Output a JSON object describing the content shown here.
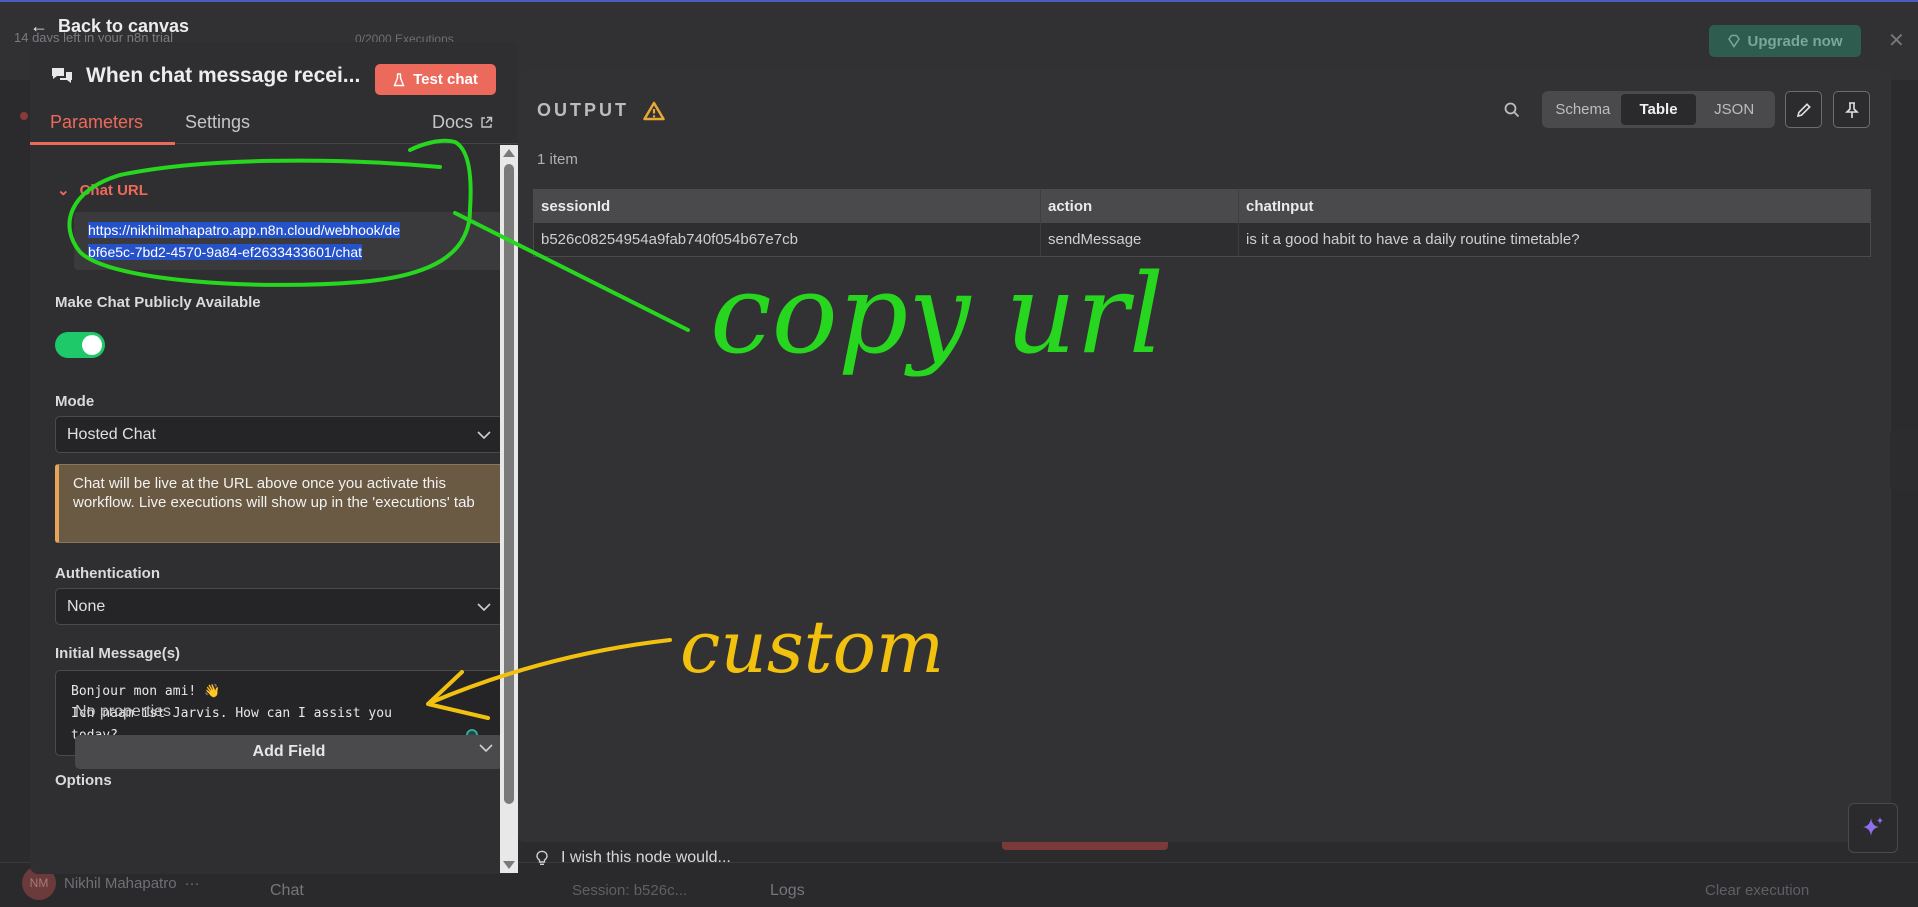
{
  "background": {
    "trial_text": "14 days left in your n8n trial",
    "executions_text": "0/2000 Executions",
    "upgrade_label": "Upgrade now",
    "user_initials": "NM",
    "user_name": "Nikhil Mahapatro",
    "chat_label": "Chat",
    "session_label": "Session: b526c...",
    "logs_label": "Logs",
    "clear_label": "Clear execution"
  },
  "back_label": "Back to canvas",
  "node": {
    "title": "When chat message recei...",
    "test_chat_label": "Test chat",
    "tabs": {
      "parameters": "Parameters",
      "settings": "Settings",
      "docs": "Docs"
    },
    "chat_url_label": "Chat URL",
    "chat_url_line1": "https://nikhilmahapatro.app.n8n.cloud/webhook/de",
    "chat_url_line2": "bf6e5c-7bd2-4570-9a84-ef2633433601/chat",
    "public_label": "Make Chat Publicly Available",
    "public_enabled": true,
    "mode_label": "Mode",
    "mode_value": "Hosted Chat",
    "notice_text": "Chat will be live at the URL above once you activate this workflow. Live executions will show up in the 'executions' tab",
    "auth_label": "Authentication",
    "auth_value": "None",
    "initial_label": "Initial Message(s)",
    "initial_line1": "Bonjour mon ami! 👋",
    "initial_line2": "Ich naam ist Jarvis. How can I assist you",
    "initial_line3": "today?",
    "options_label": "Options",
    "no_properties": "No properties",
    "add_field_label": "Add Field"
  },
  "output": {
    "title": "OUTPUT",
    "views": [
      "Schema",
      "Table",
      "JSON"
    ],
    "active_view": "Table",
    "items_count": "1 item",
    "columns": [
      "sessionId",
      "action",
      "chatInput"
    ],
    "rows": [
      [
        "b526c08254954a9fab740f054b67e7cb",
        "sendMessage",
        "is it a good habit to have a daily routine timetable?"
      ]
    ],
    "feedback_text": "I wish this node would..."
  },
  "annotations": {
    "copy_url": "copy url",
    "custom": "custom",
    "green": "#27d61e",
    "yellow": "#f2c10f"
  }
}
